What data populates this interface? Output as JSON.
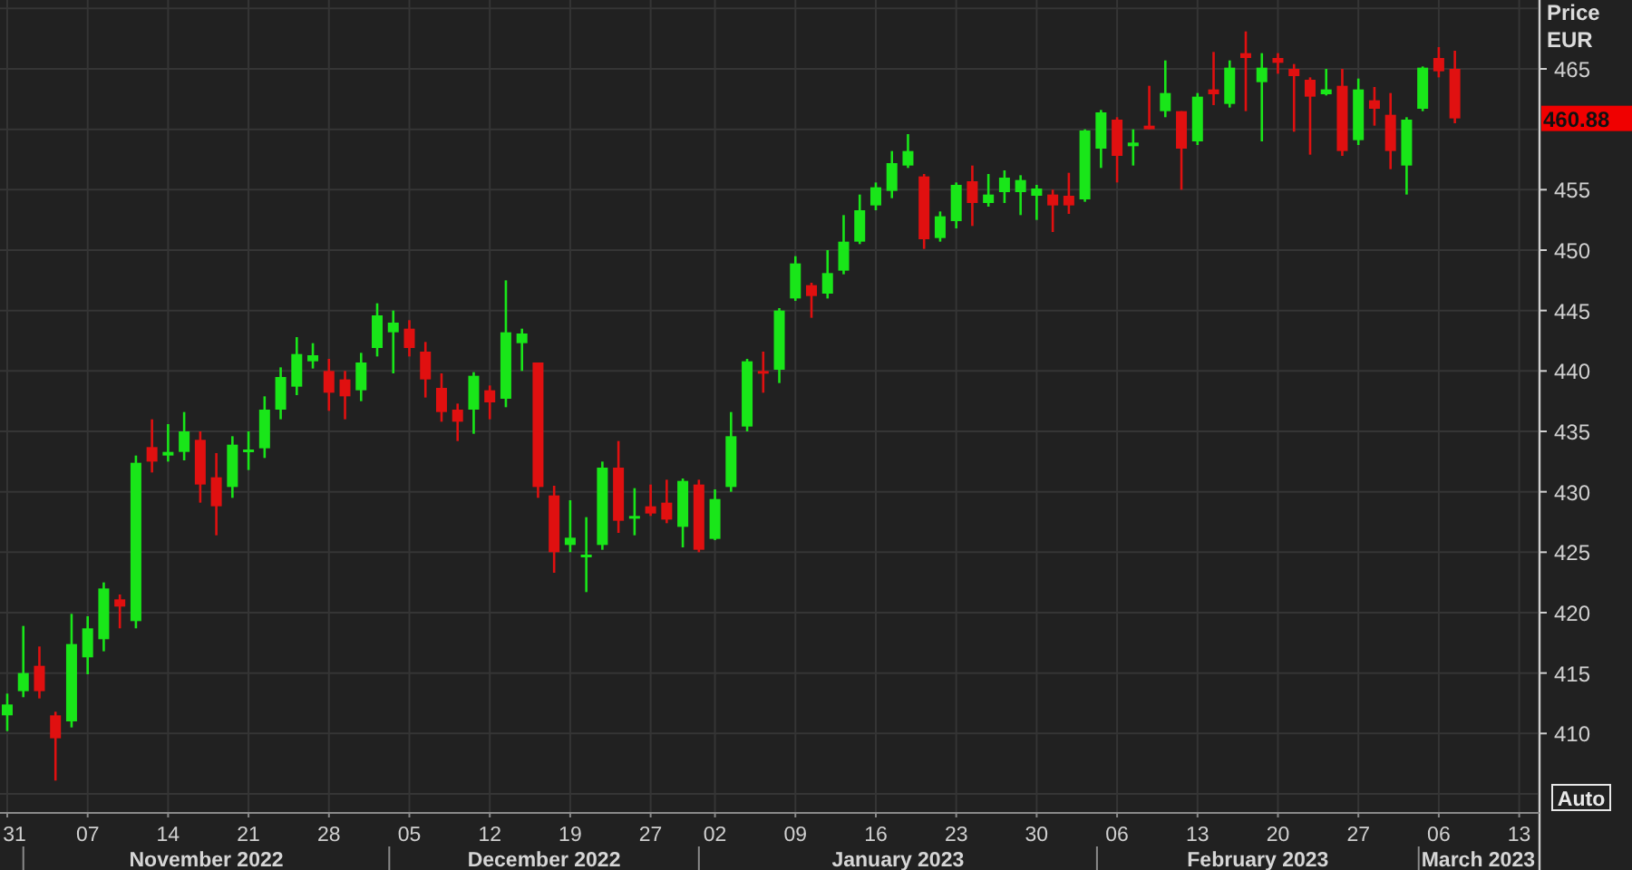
{
  "chart": {
    "last_price": "460.88",
    "chart_data": {
      "type": "candlestick",
      "ylabel": "Price EUR",
      "ylim": [
        403.5,
        470.7
      ],
      "grid": true,
      "categories": [
        "31",
        null,
        null,
        null,
        null,
        "07",
        null,
        null,
        null,
        null,
        "14",
        null,
        null,
        null,
        null,
        "21",
        null,
        null,
        null,
        null,
        "28",
        null,
        null,
        null,
        null,
        "05",
        null,
        null,
        null,
        null,
        "12",
        null,
        null,
        null,
        null,
        "19",
        null,
        null,
        null,
        null,
        "27",
        null,
        null,
        null,
        "02",
        null,
        null,
        null,
        null,
        "09",
        null,
        null,
        null,
        null,
        "16",
        null,
        null,
        null,
        null,
        "23",
        null,
        null,
        null,
        null,
        "30",
        null,
        null,
        null,
        null,
        "06",
        null,
        null,
        null,
        null,
        "13",
        null,
        null,
        null,
        null,
        "20",
        null,
        null,
        null,
        null,
        "27",
        null,
        null,
        null,
        null,
        "06",
        null,
        null,
        null,
        null,
        "13"
      ],
      "yticks": [
        410,
        415,
        420,
        425,
        430,
        435,
        440,
        445,
        450,
        455,
        465
      ],
      "annotations": [
        "November 2022",
        "December 2022",
        "January 2023",
        "February 2023",
        "March 2023"
      ],
      "ohlc": [
        [
          411.5,
          413.3,
          410.2,
          412.4
        ],
        [
          413.5,
          418.9,
          413.0,
          415.0
        ],
        [
          415.6,
          417.2,
          412.9,
          413.5
        ],
        [
          411.5,
          411.8,
          406.1,
          409.6
        ],
        [
          411.0,
          419.9,
          410.5,
          417.4
        ],
        [
          416.3,
          419.7,
          414.9,
          418.7
        ],
        [
          417.8,
          422.5,
          416.8,
          422.0
        ],
        [
          421.1,
          421.5,
          418.7,
          420.5
        ],
        [
          419.3,
          433.0,
          418.7,
          432.4
        ],
        [
          433.7,
          436.0,
          431.6,
          432.5
        ],
        [
          433.0,
          435.6,
          432.5,
          433.3
        ],
        [
          433.3,
          436.6,
          432.6,
          435.0
        ],
        [
          434.3,
          435.0,
          429.1,
          430.6
        ],
        [
          431.2,
          433.2,
          426.4,
          428.8
        ],
        [
          430.4,
          434.6,
          429.5,
          433.9
        ],
        [
          433.3,
          435.0,
          431.8,
          433.5
        ],
        [
          433.6,
          437.9,
          432.8,
          436.8
        ],
        [
          436.8,
          440.3,
          436.0,
          439.5
        ],
        [
          438.7,
          442.8,
          438.0,
          441.4
        ],
        [
          440.8,
          442.3,
          440.2,
          441.3
        ],
        [
          440.0,
          441.0,
          436.7,
          438.2
        ],
        [
          439.3,
          440.0,
          436.0,
          437.9
        ],
        [
          438.4,
          441.5,
          437.5,
          440.7
        ],
        [
          441.9,
          445.6,
          441.2,
          444.6
        ],
        [
          443.2,
          445.0,
          439.8,
          444.0
        ],
        [
          443.5,
          444.2,
          441.2,
          441.9
        ],
        [
          441.6,
          442.4,
          437.8,
          439.3
        ],
        [
          438.6,
          439.8,
          435.8,
          436.6
        ],
        [
          436.8,
          437.3,
          434.2,
          435.8
        ],
        [
          436.8,
          439.9,
          434.8,
          439.6
        ],
        [
          438.4,
          438.8,
          436.0,
          437.4
        ],
        [
          437.7,
          447.5,
          437.0,
          443.2
        ],
        [
          442.3,
          443.5,
          440.0,
          443.1
        ],
        [
          440.7,
          440.7,
          429.5,
          430.4
        ],
        [
          429.7,
          430.5,
          423.3,
          425.0
        ],
        [
          425.6,
          429.3,
          425.0,
          426.2
        ],
        [
          424.6,
          427.9,
          421.7,
          424.8
        ],
        [
          425.6,
          432.5,
          425.2,
          432.0
        ],
        [
          432.0,
          434.2,
          426.6,
          427.6
        ],
        [
          427.8,
          430.3,
          426.4,
          428.0
        ],
        [
          428.8,
          430.6,
          428.0,
          428.2
        ],
        [
          429.1,
          431.0,
          427.4,
          427.7
        ],
        [
          427.1,
          431.1,
          425.4,
          430.9
        ],
        [
          430.6,
          431.0,
          425.0,
          425.2
        ],
        [
          426.1,
          430.2,
          426.0,
          429.4
        ],
        [
          430.4,
          436.6,
          430.0,
          434.6
        ],
        [
          435.4,
          441.0,
          435.0,
          440.8
        ],
        [
          440.0,
          441.6,
          438.2,
          439.8
        ],
        [
          440.1,
          445.2,
          439.0,
          445.0
        ],
        [
          446.0,
          449.5,
          445.8,
          448.9
        ],
        [
          447.1,
          447.3,
          444.4,
          446.2
        ],
        [
          446.4,
          450.0,
          446.0,
          448.1
        ],
        [
          448.3,
          452.9,
          448.0,
          450.7
        ],
        [
          450.7,
          454.6,
          450.5,
          453.3
        ],
        [
          453.7,
          455.6,
          453.3,
          455.2
        ],
        [
          454.9,
          458.2,
          454.3,
          457.2
        ],
        [
          457.0,
          459.6,
          456.8,
          458.2
        ],
        [
          456.1,
          456.3,
          450.1,
          450.9
        ],
        [
          451.0,
          453.2,
          450.7,
          452.8
        ],
        [
          452.4,
          455.6,
          451.8,
          455.4
        ],
        [
          455.7,
          457.0,
          452.0,
          453.9
        ],
        [
          453.9,
          456.3,
          453.6,
          454.6
        ],
        [
          454.8,
          456.6,
          453.9,
          456.0
        ],
        [
          454.8,
          456.2,
          452.9,
          455.8
        ],
        [
          454.5,
          455.4,
          452.5,
          455.1
        ],
        [
          454.6,
          455.0,
          451.5,
          453.7
        ],
        [
          454.5,
          456.4,
          453.0,
          453.7
        ],
        [
          454.2,
          460.0,
          454.0,
          459.9
        ],
        [
          458.4,
          461.6,
          456.8,
          461.4
        ],
        [
          460.8,
          461.0,
          455.6,
          457.8
        ],
        [
          458.6,
          460.0,
          457.0,
          458.9
        ],
        [
          460.3,
          463.6,
          460.0,
          460.0
        ],
        [
          461.5,
          465.7,
          461.0,
          463.0
        ],
        [
          461.5,
          461.5,
          455.0,
          458.4
        ],
        [
          459.0,
          463.0,
          458.7,
          462.7
        ],
        [
          463.3,
          466.4,
          462.0,
          462.9
        ],
        [
          462.1,
          465.7,
          461.8,
          465.1
        ],
        [
          466.3,
          468.1,
          461.5,
          465.9
        ],
        [
          463.9,
          466.3,
          459.0,
          465.1
        ],
        [
          465.9,
          466.3,
          464.6,
          465.5
        ],
        [
          465.0,
          465.4,
          459.8,
          464.4
        ],
        [
          464.1,
          464.3,
          457.9,
          462.7
        ],
        [
          462.9,
          465.0,
          462.8,
          463.3
        ],
        [
          463.6,
          465.0,
          457.8,
          458.2
        ],
        [
          459.1,
          464.2,
          458.7,
          463.3
        ],
        [
          462.4,
          463.5,
          460.3,
          461.7
        ],
        [
          461.2,
          463.0,
          456.7,
          458.2
        ],
        [
          457.0,
          461.0,
          454.6,
          460.8
        ],
        [
          461.7,
          465.2,
          461.5,
          465.1
        ],
        [
          465.9,
          466.8,
          464.3,
          464.8
        ],
        [
          465.0,
          466.5,
          460.5,
          460.9
        ],
        null,
        null,
        null,
        null
      ]
    }
  },
  "auto_button": {
    "label": "Auto"
  }
}
